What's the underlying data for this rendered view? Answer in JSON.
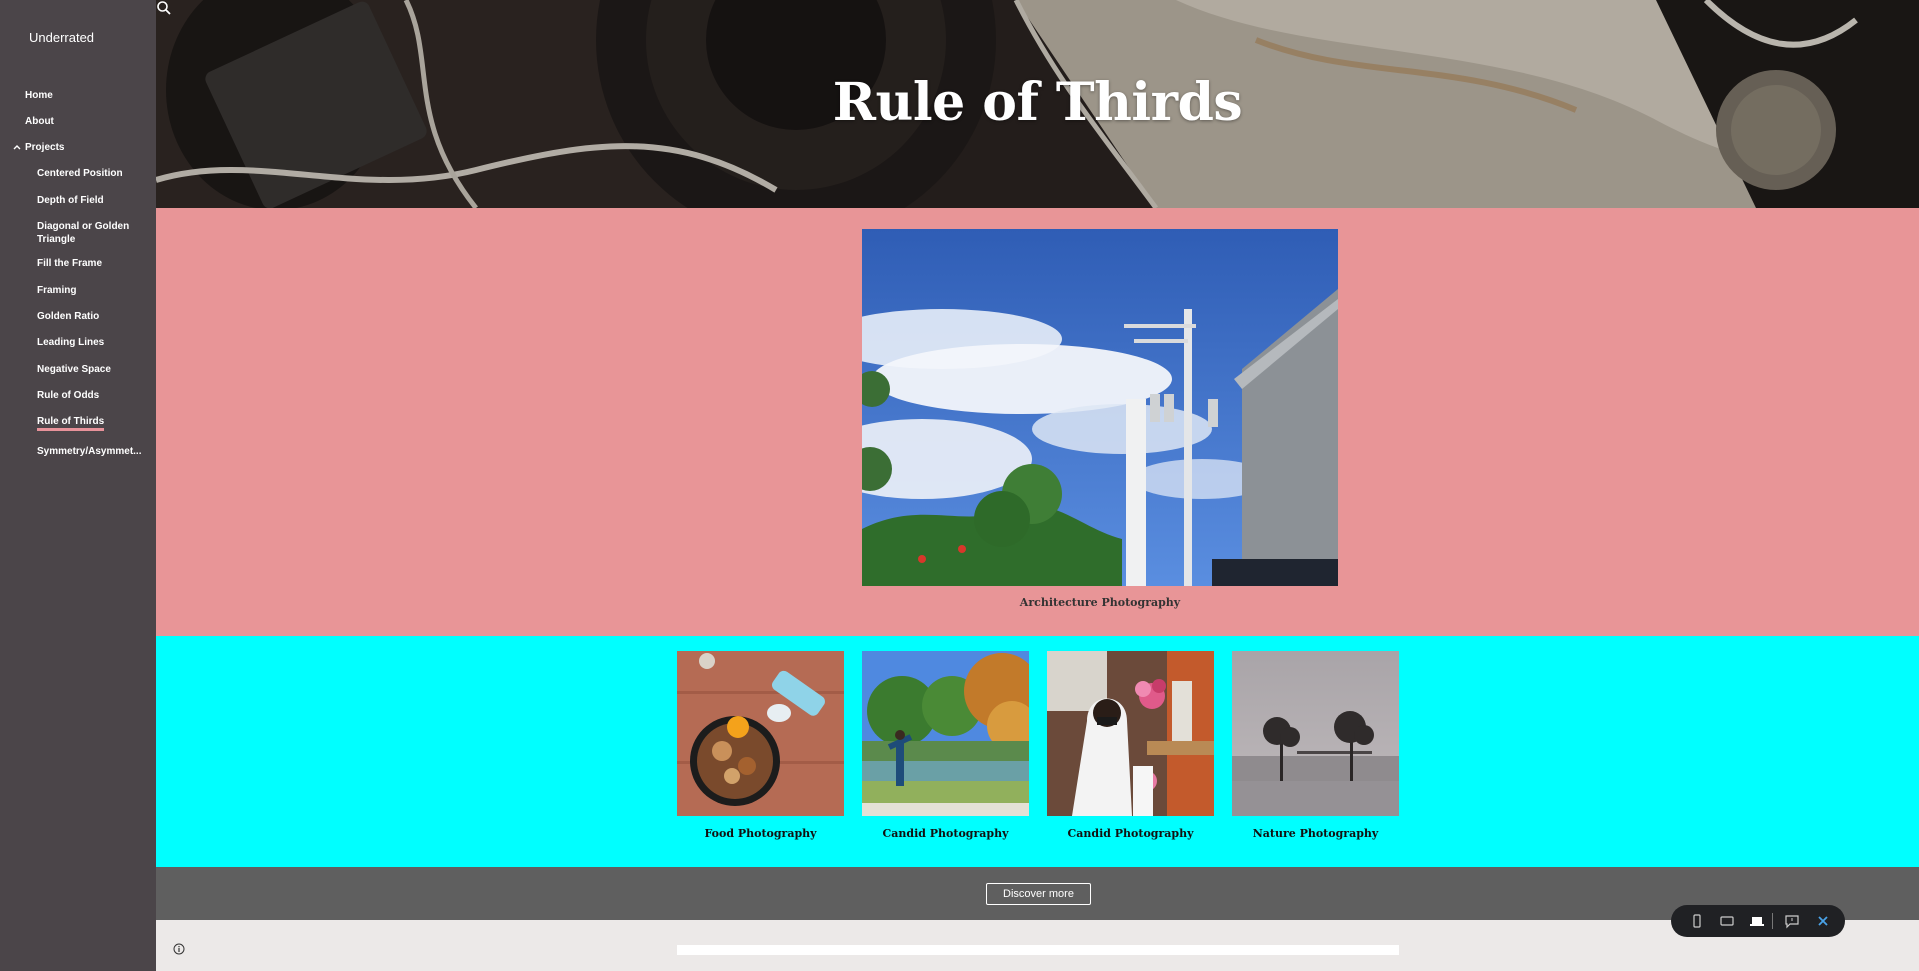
{
  "site": {
    "title": "Underrated"
  },
  "nav": {
    "home": "Home",
    "about": "About",
    "projects": "Projects",
    "children": [
      "Centered Position",
      "Depth of Field",
      "Diagonal or Golden Triangle",
      "Fill the Frame",
      "Framing",
      "Golden Ratio",
      "Leading Lines",
      "Negative Space",
      "Rule of Odds",
      "Rule of Thirds",
      "Symmetry/Asymmet..."
    ],
    "active": "Rule of Thirds"
  },
  "hero": {
    "title": "Rule of Thirds"
  },
  "feature": {
    "caption": "Architecture Photography"
  },
  "gallery": [
    {
      "caption": "Food Photography"
    },
    {
      "caption": "Candid Photography"
    },
    {
      "caption": "Candid Photography"
    },
    {
      "caption": "Nature Photography"
    }
  ],
  "discover": {
    "label": "Discover more"
  },
  "icons": {
    "search": "search-icon",
    "info": "info-icon",
    "toolbar": [
      "phone-preview-icon",
      "tablet-preview-icon",
      "laptop-preview-icon",
      "feedback-icon",
      "close-icon"
    ]
  },
  "colors": {
    "sidebar": "#4b4549",
    "pink_section": "#e89597",
    "cyan_section": "#00ffff",
    "grey_section": "#5f5f5f",
    "active_underline": "#e8929a",
    "close_accent": "#4aa3e8"
  }
}
